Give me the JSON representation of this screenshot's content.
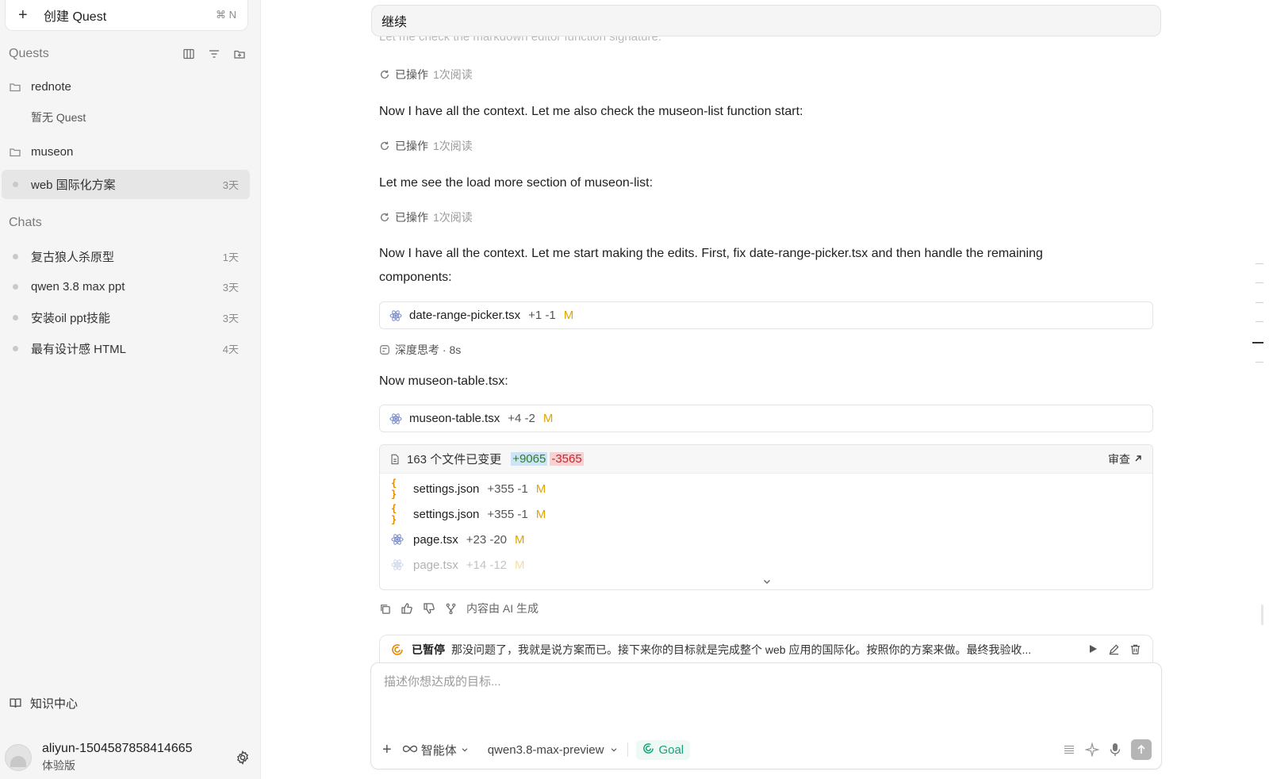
{
  "sidebar": {
    "new_quest": {
      "label": "创建 Quest",
      "shortcut": "⌘ N"
    },
    "quests_title": "Quests",
    "groups": [
      {
        "name": "rednote",
        "empty_text": "暂无 Quest"
      },
      {
        "name": "museon",
        "items": [
          {
            "label": "web 国际化方案",
            "age": "3天"
          }
        ]
      }
    ],
    "chats_title": "Chats",
    "chats": [
      {
        "label": "复古狼人杀原型",
        "age": "1天"
      },
      {
        "label": "qwen 3.8 max ppt",
        "age": "3天"
      },
      {
        "label": "安装oil ppt技能",
        "age": "3天"
      },
      {
        "label": "最有设计感 HTML",
        "age": "4天"
      }
    ],
    "knowledge_center": "知识中心",
    "user": {
      "name": "aliyun-1504587858414665",
      "plan": "体验版"
    }
  },
  "main": {
    "top_message": "继续",
    "faded_line": "Let me check the markdown editor function signature:",
    "ops": [
      {
        "label": "已操作",
        "detail": "1次阅读"
      },
      {
        "label": "已操作",
        "detail": "1次阅读"
      },
      {
        "label": "已操作",
        "detail": "1次阅读"
      }
    ],
    "paragraphs": [
      "Now I have all the context. Let me also check the museon-list function start:",
      "Let me see the load more section of museon-list:",
      "Now I have all the context. Let me start making the edits. First, fix date-range-picker.tsx and then handle the remaining components:",
      "Now museon-table.tsx:"
    ],
    "file_cards": [
      {
        "name": "date-range-picker.tsx",
        "stat": "+1 -1",
        "status": "M"
      },
      {
        "name": "museon-table.tsx",
        "stat": "+4 -2",
        "status": "M"
      }
    ],
    "thinking": "深度思考 · 8s",
    "changes": {
      "summary": "163 个文件已变更",
      "additions": "+9065",
      "deletions": "-3565",
      "review_label": "审查",
      "files": [
        {
          "name": "settings.json",
          "stat": "+355 -1",
          "status": "M",
          "icon": "json-icon"
        },
        {
          "name": "settings.json",
          "stat": "+355 -1",
          "status": "M",
          "icon": "json-icon"
        },
        {
          "name": "page.tsx",
          "stat": "+23 -20",
          "status": "M",
          "icon": "react-icon"
        },
        {
          "name": "page.tsx",
          "stat": "+14 -12",
          "status": "M",
          "icon": "react-icon"
        }
      ]
    },
    "ai_note": "内容由 AI 生成",
    "paused": {
      "state": "已暂停",
      "message": "那没问题了，我就是说方案而已。接下来你的目标就是完成整个 web 应用的国际化。按照你的方案来做。最终我验收..."
    },
    "composer": {
      "placeholder": "描述你想达成的目标...",
      "agent_label": "智能体",
      "model": "qwen3.8-max-preview",
      "goal_label": "Goal"
    }
  },
  "colors": {
    "accent_green": "#18a07a",
    "modified": "#e3a300",
    "paused_icon": "#e58a00"
  }
}
